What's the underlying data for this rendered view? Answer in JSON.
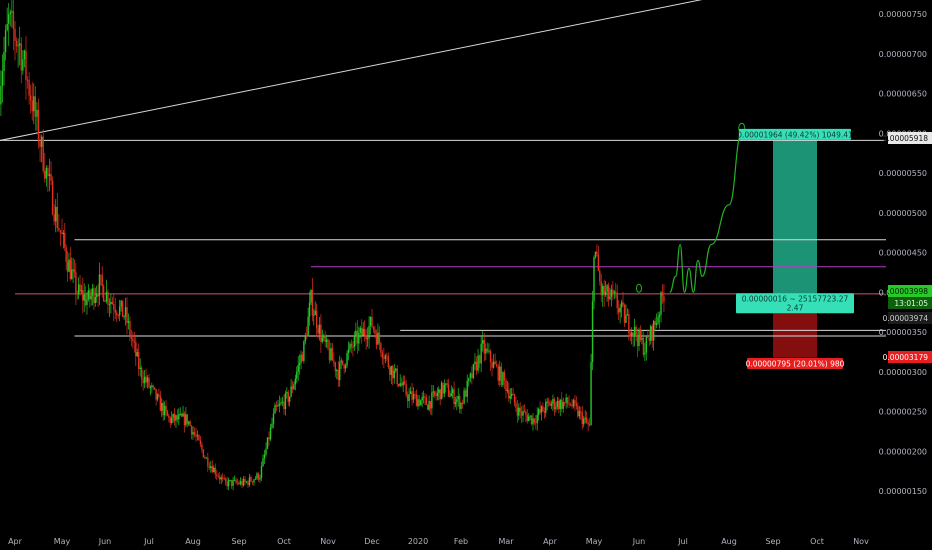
{
  "chart_data": {
    "type": "candlestick",
    "title": "",
    "xlabel": "",
    "ylabel": "",
    "ylim": [
      1.3e-06,
      7.7e-06
    ],
    "grid": false,
    "colors": {
      "background": "#000000",
      "up": "#26c926",
      "down": "#e0321e",
      "horizontal_line": "#d9d9d9",
      "trendline": "#d9d9d9",
      "magenta_line": "#b03cc4",
      "profit_zone": "#20a383",
      "loss_zone": "#8b0f0f",
      "projection": "#22b322"
    },
    "x_axis": {
      "labels": [
        "Apr",
        "May",
        "Jun",
        "Jul",
        "Aug",
        "Sep",
        "Oct",
        "Nov",
        "Dec",
        "2020",
        "Feb",
        "Mar",
        "Apr",
        "May",
        "Jun",
        "Jul",
        "Aug",
        "Sep",
        "Oct",
        "Nov"
      ],
      "label_dates": [
        "2019-04-01",
        "2019-05-01",
        "2019-06-01",
        "2019-07-01",
        "2019-08-01",
        "2019-09-01",
        "2019-10-01",
        "2019-11-01",
        "2019-12-01",
        "2020-01-01",
        "2020-02-01",
        "2020-03-01",
        "2020-04-01",
        "2020-05-01",
        "2020-06-01",
        "2020-07-01",
        "2020-08-01",
        "2020-09-01",
        "2020-10-01",
        "2020-11-01"
      ]
    },
    "y_axis": {
      "ticks": [
        1.5e-06,
        2e-06,
        2.5e-06,
        3e-06,
        3.5e-06,
        4e-06,
        4.5e-06,
        5e-06,
        5.5e-06,
        6e-06,
        6.5e-06,
        7e-06,
        7.5e-06
      ],
      "tick_labels": [
        "0.00000150",
        "0.00000200",
        "0.00000250",
        "0.00000300",
        "0.00000350",
        "0.00000400",
        "0.00000450",
        "0.00000500",
        "0.00000550",
        "0.00000600",
        "0.00000650",
        "0.00000700",
        "0.00000750"
      ]
    },
    "price_path": [
      {
        "date": "2019-03-22",
        "price": 6.6e-06
      },
      {
        "date": "2019-03-28",
        "price": 7.4e-06
      },
      {
        "date": "2019-04-04",
        "price": 7.1e-06
      },
      {
        "date": "2019-04-12",
        "price": 6.4e-06
      },
      {
        "date": "2019-04-20",
        "price": 5.6e-06
      },
      {
        "date": "2019-04-28",
        "price": 4.9e-06
      },
      {
        "date": "2019-05-05",
        "price": 4.4e-06
      },
      {
        "date": "2019-05-12",
        "price": 4e-06
      },
      {
        "date": "2019-05-20",
        "price": 3.9e-06
      },
      {
        "date": "2019-05-28",
        "price": 4.1e-06
      },
      {
        "date": "2019-06-05",
        "price": 3.9e-06
      },
      {
        "date": "2019-06-15",
        "price": 3.7e-06
      },
      {
        "date": "2019-06-25",
        "price": 3e-06
      },
      {
        "date": "2019-07-05",
        "price": 2.7e-06
      },
      {
        "date": "2019-07-15",
        "price": 2.4e-06
      },
      {
        "date": "2019-07-28",
        "price": 2.4e-06
      },
      {
        "date": "2019-08-10",
        "price": 1.9e-06
      },
      {
        "date": "2019-08-22",
        "price": 1.6e-06
      },
      {
        "date": "2019-09-05",
        "price": 1.6e-06
      },
      {
        "date": "2019-09-15",
        "price": 1.7e-06
      },
      {
        "date": "2019-09-25",
        "price": 2.5e-06
      },
      {
        "date": "2019-10-05",
        "price": 2.7e-06
      },
      {
        "date": "2019-10-15",
        "price": 3.3e-06
      },
      {
        "date": "2019-10-20",
        "price": 3.9e-06
      },
      {
        "date": "2019-10-28",
        "price": 3.4e-06
      },
      {
        "date": "2019-11-08",
        "price": 3e-06
      },
      {
        "date": "2019-11-20",
        "price": 3.4e-06
      },
      {
        "date": "2019-12-01",
        "price": 3.6e-06
      },
      {
        "date": "2019-12-12",
        "price": 3.1e-06
      },
      {
        "date": "2019-12-25",
        "price": 2.7e-06
      },
      {
        "date": "2020-01-08",
        "price": 2.6e-06
      },
      {
        "date": "2020-01-20",
        "price": 2.8e-06
      },
      {
        "date": "2020-02-01",
        "price": 2.6e-06
      },
      {
        "date": "2020-02-15",
        "price": 3.3e-06
      },
      {
        "date": "2020-02-28",
        "price": 2.9e-06
      },
      {
        "date": "2020-03-10",
        "price": 2.5e-06
      },
      {
        "date": "2020-03-20",
        "price": 2.4e-06
      },
      {
        "date": "2020-04-01",
        "price": 2.6e-06
      },
      {
        "date": "2020-04-15",
        "price": 2.6e-06
      },
      {
        "date": "2020-04-28",
        "price": 2.3e-06
      },
      {
        "date": "2020-05-01",
        "price": 4.6e-06
      },
      {
        "date": "2020-05-06",
        "price": 4e-06
      },
      {
        "date": "2020-05-15",
        "price": 3.9e-06
      },
      {
        "date": "2020-05-25",
        "price": 3.6e-06
      },
      {
        "date": "2020-06-05",
        "price": 3.3e-06
      },
      {
        "date": "2020-06-12",
        "price": 3.6e-06
      },
      {
        "date": "2020-06-18",
        "price": 4e-06
      }
    ],
    "horizontal_lines": [
      {
        "price": 5.91e-06,
        "x_start": "2019-03-20"
      },
      {
        "price": 4.66e-06,
        "x_start": "2019-05-10"
      },
      {
        "price": 4.32e-06,
        "x_start": "2019-10-20",
        "color": "magenta"
      },
      {
        "price": 3.98e-06,
        "x_start": "2019-04-01",
        "color": "pink"
      },
      {
        "price": 3.52e-06,
        "x_start": "2019-12-20"
      },
      {
        "price": 3.45e-06,
        "x_start": "2019-05-10"
      }
    ],
    "trendline": {
      "start": {
        "date": "2019-03-20",
        "price": 5.9e-06
      },
      "end": {
        "date": "2020-08-15",
        "price": 7.8e-06
      }
    },
    "position": {
      "start_date": "2020-09-01",
      "end_date": "2020-10-01",
      "entry": 3.9e-06,
      "target": 5.91e-06,
      "stop": 3.18e-06,
      "target_label": "0.00001964 (49.42%) 1049.41",
      "entry_label_line1": "0.00000016 ~ 25157723.27",
      "entry_label_line2": "2.47",
      "stop_label": "0.00000795 (20.01%) 980"
    },
    "projection_path": [
      {
        "date": "2020-06-22",
        "price": 4e-06
      },
      {
        "date": "2020-06-26",
        "price": 4.2e-06
      },
      {
        "date": "2020-06-29",
        "price": 4.6e-06
      },
      {
        "date": "2020-07-02",
        "price": 4e-06
      },
      {
        "date": "2020-07-05",
        "price": 4.3e-06
      },
      {
        "date": "2020-07-08",
        "price": 4e-06
      },
      {
        "date": "2020-07-11",
        "price": 4.4e-06
      },
      {
        "date": "2020-07-14",
        "price": 4.2e-06
      },
      {
        "date": "2020-07-20",
        "price": 4.6e-06
      },
      {
        "date": "2020-08-01",
        "price": 5.1e-06
      },
      {
        "date": "2020-08-10",
        "price": 6e-06
      }
    ],
    "price_tags": [
      {
        "label": "0.00005918",
        "price": 5.91e-06,
        "style": "target"
      },
      {
        "label": "0.00003998",
        "price": 4e-06,
        "style": "green"
      },
      {
        "label": "13:01:05",
        "price": 3.9e-06,
        "style": "green-dark"
      },
      {
        "label": "0.00003974",
        "price": 3.765e-06,
        "style": "grey"
      },
      {
        "label": "0.00003179",
        "price": 3.18e-06,
        "style": "red"
      }
    ]
  }
}
